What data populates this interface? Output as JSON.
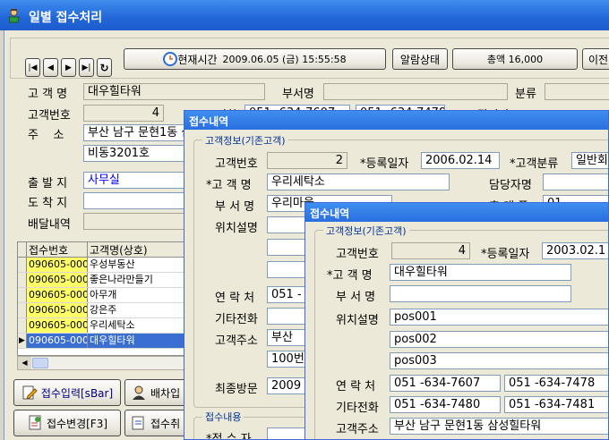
{
  "window": {
    "title": "일별 접수처리"
  },
  "toolbar": {
    "first": "first-record",
    "prev": "prev-record",
    "next": "next-record",
    "last": "last-record",
    "refresh": "refresh",
    "current_time_label": "현재시간",
    "current_time_value": "2009.06.05 (금)  15:55:58",
    "alarm_button": "알람상태",
    "total_button": "총액 16,000",
    "prev_button": "이전"
  },
  "form": {
    "customer_name_label": "고 객 명",
    "customer_name_value": "대우힐타워",
    "department_label": "부서명",
    "category_label": "분류",
    "customer_no_label": "고객번호",
    "customer_no_value": "4",
    "contact_label": "전화번호",
    "contact_value_1": "051 -634-7607",
    "contact_value_2": "051 -634-7478",
    "manager_label": "담당자",
    "address_label": "주    소",
    "address_value": "부산 남구 문현1동 삼성힐타워",
    "address_detail": "비동3201호",
    "origin_label": "출 발 지",
    "origin_value": "사무실",
    "destination_label": "도 착 지",
    "delivery_label": "배달내역"
  },
  "grid": {
    "headers": [
      "접수번호",
      "고객명(상호)"
    ],
    "rows": [
      {
        "no": "090605-0001",
        "name": "우성부동산"
      },
      {
        "no": "090605-0002",
        "name": "좋은나라만들기"
      },
      {
        "no": "090605-0003",
        "name": "아무개"
      },
      {
        "no": "090605-0004",
        "name": "강은주"
      },
      {
        "no": "090605-0005",
        "name": "우리세탁소"
      },
      {
        "no": "090605-0006",
        "name": "대우힐타워"
      }
    ],
    "selected_indicator": "▶"
  },
  "bottom_buttons": {
    "intake_input": "접수입력[sBar]",
    "dispatch": "배차입",
    "intake_change": "접수변경[F3]",
    "intake_cancel": "접수취"
  },
  "dialog1": {
    "title": "접수내역",
    "group_customer": "고객정보(기존고객)",
    "customer_no_label": "고객번호",
    "customer_no_value": "2",
    "reg_date_label": "*등록일자",
    "reg_date_value": "2006.02.14",
    "category_label": "*고객분류",
    "category_value": "일반회",
    "customer_name_label": "*고 객 명",
    "customer_name_value": "우리세탁소",
    "manager_label": "담당자명",
    "department_label": "부 서 명",
    "department_value": "우리마을",
    "phone_label": "휴 대 폰",
    "phone_value": "01",
    "location_label": "위치설명",
    "contact_label": "연 락 처",
    "contact_value": "051 -",
    "other_phone_label": "기타전화",
    "address_label": "고객주소",
    "address_value": "부산",
    "address_detail": "100번",
    "last_visit_label": "최종방문",
    "last_visit_value": "2009",
    "group_intake": "접수내용",
    "intake_person_label": "*접 수 자"
  },
  "dialog2": {
    "title": "접수내역",
    "group_customer": "고객정보(기존고객)",
    "customer_no_label": "고객번호",
    "customer_no_value": "4",
    "reg_date_label": "*등록일자",
    "reg_date_value": "2003.02.1",
    "customer_name_label": "*고 객 명",
    "customer_name_value": "대우힐타워",
    "department_label": "부 서 명",
    "location_label": "위치설명",
    "location_1": "pos001",
    "location_2": "pos002",
    "location_3": "pos003",
    "contact_label": "연 락 처",
    "contact_value_1": "051 -634-7607",
    "contact_value_2": "051 -634-7478",
    "other_phone_label": "기타전화",
    "other_phone_1": "051 -634-7480",
    "other_phone_2": "051 -634-7481",
    "address_label": "고객주소",
    "address_value": "부산 남구 문현1동 삼성힐타워"
  },
  "colors": {
    "titlebar": "#2266d8",
    "highlight": "#ffff66",
    "selected_row": "#3a6ed0",
    "origin_text": "#0000ff",
    "group_label": "#003399"
  }
}
